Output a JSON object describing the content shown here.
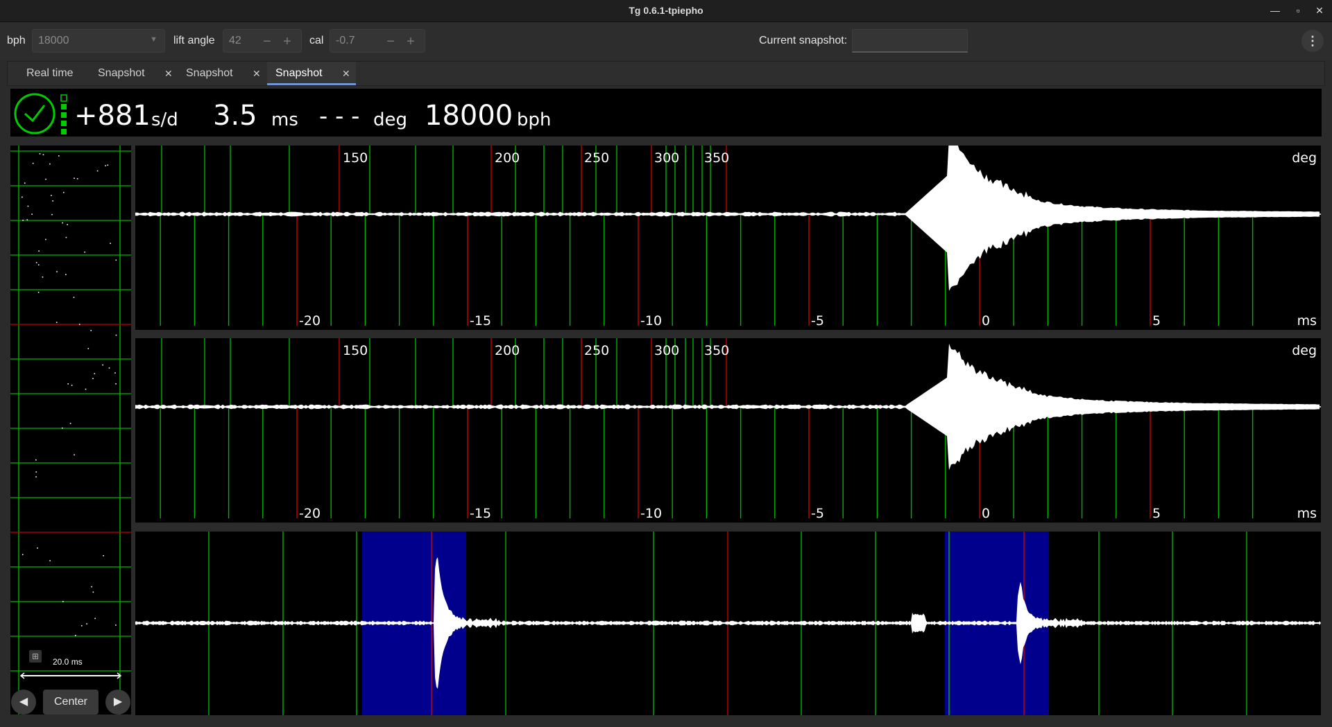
{
  "window": {
    "title": "Tg 0.6.1-tpiepho",
    "minimize_icon": "minimize-icon",
    "maximize_icon": "maximize-icon",
    "close_icon": "close-icon"
  },
  "toolbar": {
    "bph_label": "bph",
    "bph_value": "18000",
    "lift_angle_label": "lift angle",
    "lift_angle_value": "42",
    "cal_label": "cal",
    "cal_value": "-0.7",
    "minus_glyph": "−",
    "plus_glyph": "+",
    "snapshot_label": "Current snapshot:",
    "snapshot_value": "",
    "menu_icon": "kebab-menu-icon"
  },
  "tabs": [
    {
      "label": "Real time",
      "closable": false,
      "active": false
    },
    {
      "label": "Snapshot",
      "closable": true,
      "active": false
    },
    {
      "label": "Snapshot",
      "closable": true,
      "active": false
    },
    {
      "label": "Snapshot",
      "closable": true,
      "active": true
    }
  ],
  "status": {
    "rate": "+881",
    "rate_unit": "s/d",
    "beat_error": "3.5",
    "beat_error_unit": "ms",
    "amplitude": "- - -",
    "amplitude_unit": "deg",
    "bph": "18000",
    "bph_unit": "bph",
    "clock_icon": "clock-check-icon",
    "signal_icon": "signal-level-icon",
    "colors": {
      "ok": "#00cc00",
      "text": "#ffffff"
    }
  },
  "waveform_panes": [
    {
      "deg_ticks": [
        "150",
        "200",
        "250",
        "300",
        "350"
      ],
      "deg_unit": "deg",
      "ms_ticks": [
        "-20",
        "-15",
        "-10",
        "-5",
        "0",
        "5"
      ],
      "ms_unit": "ms"
    },
    {
      "deg_ticks": [
        "150",
        "200",
        "250",
        "300",
        "350"
      ],
      "deg_unit": "deg",
      "ms_ticks": [
        "-20",
        "-15",
        "-10",
        "-5",
        "0",
        "5"
      ],
      "ms_unit": "ms"
    }
  ],
  "paperstrip": {
    "scale_label": "20.0 ms",
    "zoom_icon": "zoom-icon"
  },
  "controls": {
    "prev_icon": "triangle-left-icon",
    "center_label": "Center",
    "next_icon": "triangle-right-icon"
  },
  "colors": {
    "grid_green": "#00b400",
    "grid_red": "#c80000",
    "highlight_blue": "#00008c",
    "signal": "#ffffff"
  }
}
